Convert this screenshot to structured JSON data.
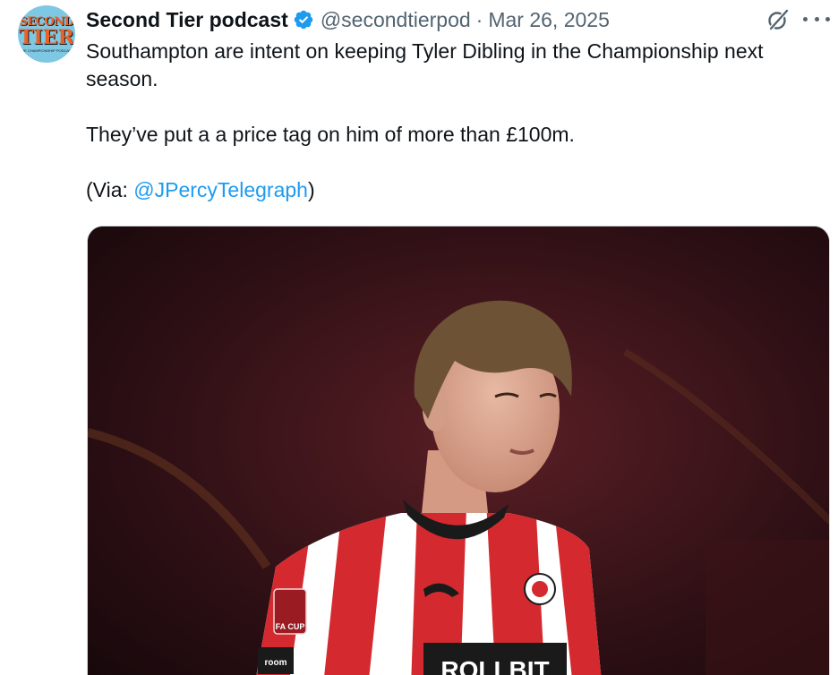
{
  "author": {
    "display_name": "Second Tier podcast",
    "handle": "@secondtierpod",
    "separator": "·",
    "date": "Mar 26, 2025",
    "verified": true,
    "avatar_lines": [
      "SECOND",
      "TIER",
      "THE CHAMPIONSHIP PODCAST"
    ]
  },
  "tweet": {
    "line1": "Southampton are intent on keeping Tyler Dibling in the Championship next season.",
    "line2": "They’ve put a a price tag on him of more than £100m.",
    "via_prefix": "(Via: ",
    "via_mention": "@JPercyTelegraph",
    "via_suffix": ")"
  },
  "media": {
    "sponsor_text": "ROLLBIT",
    "badge_text": "FA CUP",
    "sleeve_text": "room"
  },
  "icons": {
    "verified": "verified-badge-icon",
    "grok": "grok-icon",
    "more": "more-options-icon"
  },
  "colors": {
    "link": "#1d9bf0",
    "secondary_text": "#536471",
    "verified": "#1d9bf0",
    "kit_red": "#d42a2f"
  }
}
